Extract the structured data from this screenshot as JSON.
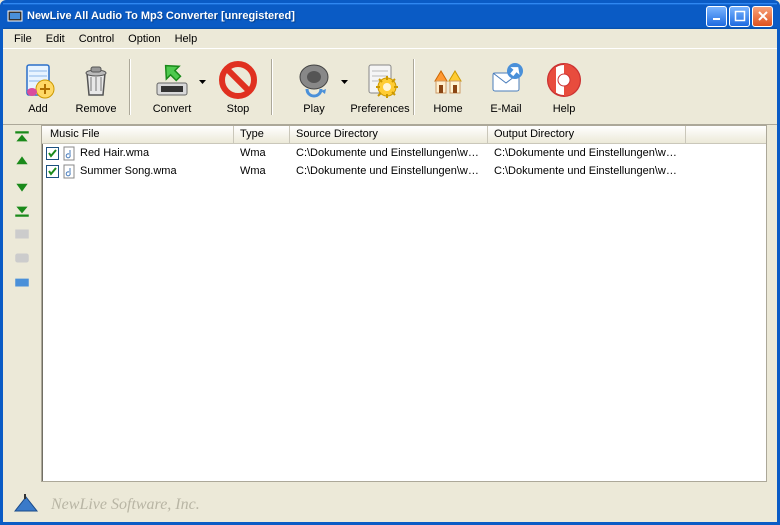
{
  "colors": {
    "accent": "#0a5bc5",
    "bg": "#ece9d8"
  },
  "title": "NewLive All Audio To Mp3 Converter  [unregistered]",
  "menu": [
    "File",
    "Edit",
    "Control",
    "Option",
    "Help"
  ],
  "toolbar": {
    "add": "Add",
    "remove": "Remove",
    "convert": "Convert",
    "stop": "Stop",
    "play": "Play",
    "preferences": "Preferences",
    "home": "Home",
    "email": "E-Mail",
    "help": "Help"
  },
  "columns": [
    "Music File",
    "Type",
    "Source Directory",
    "Output Directory"
  ],
  "rows": [
    {
      "checked": true,
      "name": "Red Hair.wma",
      "type": "Wma",
      "src": "C:\\Dokumente und Einstellungen\\wo...",
      "out": "C:\\Dokumente und Einstellungen\\wo..."
    },
    {
      "checked": true,
      "name": "Summer Song.wma",
      "type": "Wma",
      "src": "C:\\Dokumente und Einstellungen\\wo...",
      "out": "C:\\Dokumente und Einstellungen\\wo..."
    }
  ],
  "footer": "NewLive Software, Inc."
}
